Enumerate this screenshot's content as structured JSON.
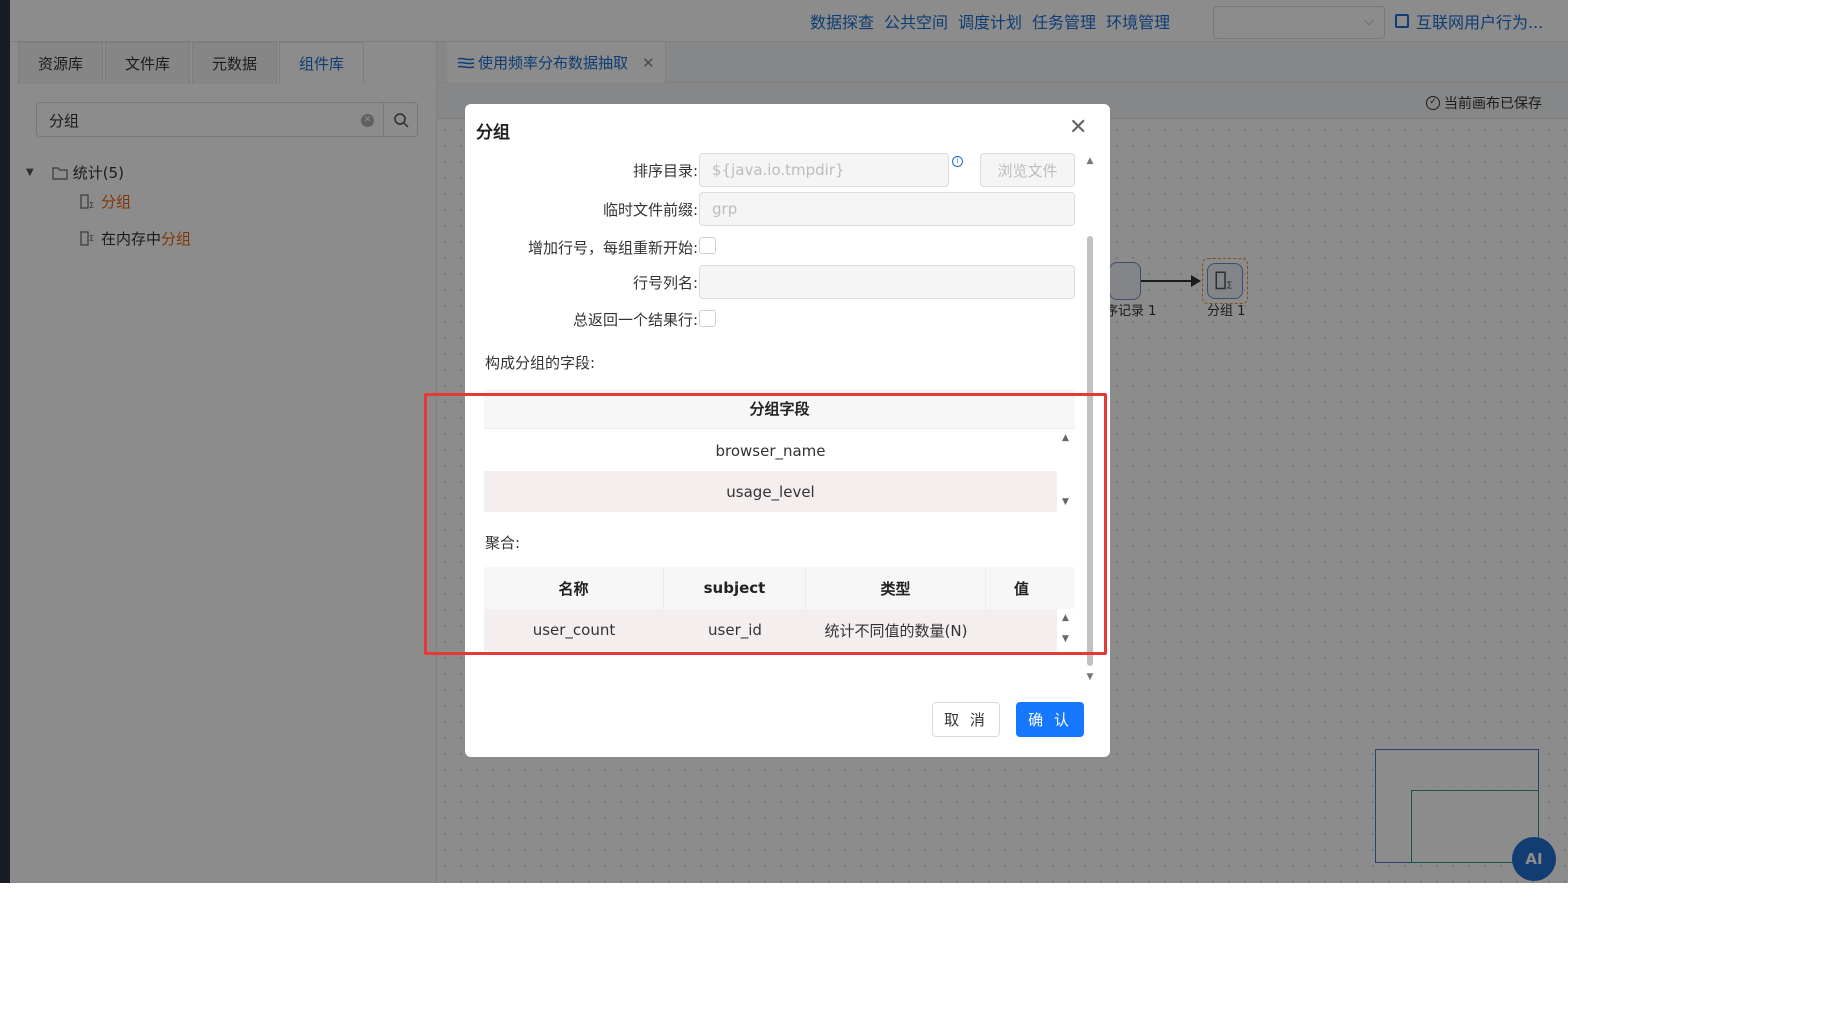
{
  "topnav": {
    "items": [
      "数据探查",
      "公共空间",
      "调度计划",
      "任务管理",
      "环境管理"
    ],
    "project": "互联网用户行为..."
  },
  "sidebar": {
    "tabs": [
      "资源库",
      "文件库",
      "元数据",
      "组件库"
    ],
    "search_value": "分组",
    "tree": {
      "root": "统计(5)",
      "items": [
        {
          "prefix": "",
          "highlight": "分组"
        },
        {
          "prefix": "在内存中 ",
          "highlight": "分组"
        }
      ]
    }
  },
  "canvas": {
    "tab": "使用频率分布数据抽取",
    "status": "当前画布已保存",
    "node_prev_label": "序记录 1",
    "node_label": "分组 1",
    "ai_label": "AI"
  },
  "dialog": {
    "title": "分组",
    "sort_dir_label": "排序目录:",
    "sort_dir_value": "${java.io.tmpdir}",
    "browse_label": "浏览文件",
    "temp_prefix_label": "临时文件前缀:",
    "temp_prefix_value": "grp",
    "add_line_label": "增加行号，每组重新开始:",
    "line_col_label": "行号列名:",
    "always_one_label": "总返回一个结果行:",
    "group_fields_label": "构成分组的字段:",
    "group_table": {
      "header": "分组字段",
      "rows": [
        "browser_name",
        "usage_level"
      ]
    },
    "agg_label": "聚合:",
    "agg_table": {
      "headers": [
        "名称",
        "subject",
        "类型",
        "值"
      ],
      "rows": [
        {
          "name": "user_count",
          "subject": "user_id",
          "type": "统计不同值的数量(N)",
          "value": ""
        }
      ]
    },
    "cancel_label": "取 消",
    "ok_label": "确 认"
  }
}
